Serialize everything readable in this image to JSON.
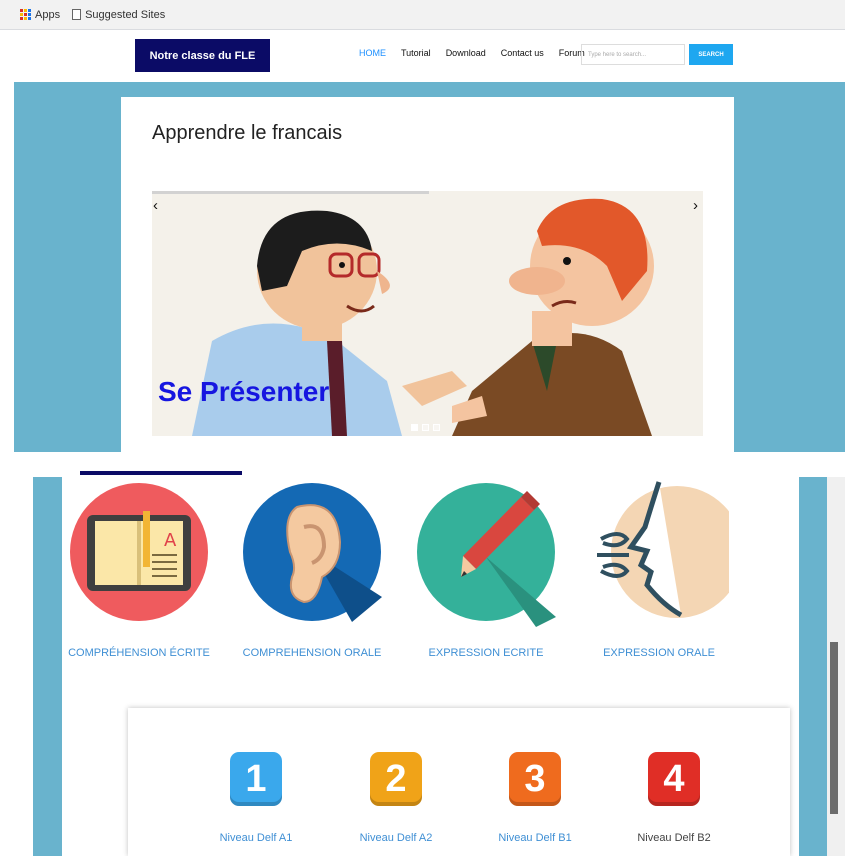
{
  "bookmarks": {
    "apps": "Apps",
    "suggested": "Suggested Sites"
  },
  "site": {
    "logo": "Notre classe du FLE",
    "nav": [
      "HOME",
      "Tutorial",
      "Download",
      "Contact us",
      "Forum"
    ],
    "search": {
      "placeholder": "Type here to search...",
      "button": "SEARCH"
    }
  },
  "hero": {
    "title": "Apprendre le francais",
    "slide_caption": "Se Présenter",
    "prev": "‹",
    "next": "›"
  },
  "skills": [
    {
      "label": "COMPRÉHENSION ÉCRITE",
      "icon": "book-icon",
      "color": "#ef5b5e"
    },
    {
      "label": "COMPREHENSION ORALE",
      "icon": "ear-icon",
      "color": "#1469b4"
    },
    {
      "label": "EXPRESSION ECRITE",
      "icon": "pencil-icon",
      "color": "#34b19a"
    },
    {
      "label": "EXPRESSION ORALE",
      "icon": "speaking-face-icon",
      "color": "#f4d6b4"
    }
  ],
  "levels": [
    {
      "number": "1",
      "label": "Niveau Delf A1",
      "color": "#3aa8ec"
    },
    {
      "number": "2",
      "label": "Niveau Delf A2",
      "color": "#f0a318"
    },
    {
      "number": "3",
      "label": "Niveau Delf B1",
      "color": "#ef6b1e"
    },
    {
      "number": "4",
      "label": "Niveau Delf B2",
      "color": "#e02e26"
    }
  ]
}
